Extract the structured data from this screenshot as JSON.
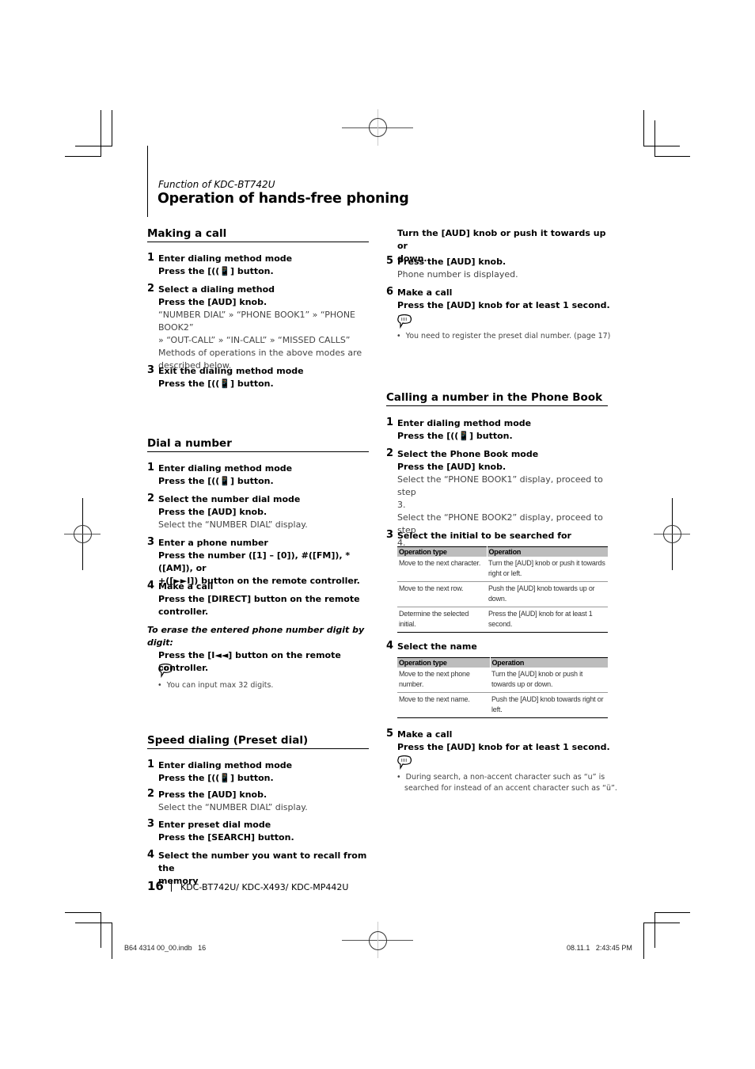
{
  "header": {
    "function_label": "Function of KDC-BT742U",
    "title": "Operation of hands-free phoning"
  },
  "making_a_call": {
    "heading": "Making a call",
    "steps": [
      {
        "num": "1",
        "title": "Enter dialing method mode",
        "action_pre": "Press the [",
        "action_post": "] button.",
        "icon": "phone-call-icon"
      },
      {
        "num": "2",
        "title": "Select a dialing method",
        "action": "Press the [AUD] knob.",
        "desc": [
          "“NUMBER DIAL” » “PHONE BOOK1” » “PHONE BOOK2”",
          "» “OUT-CALL” » “IN-CALL” » “MISSED CALLS”",
          "Methods of operations in the above modes are",
          "described below."
        ]
      },
      {
        "num": "3",
        "title": "Exit the dialing method mode",
        "action_pre": "Press the [",
        "action_post": "] button.",
        "icon": "phone-call-icon"
      }
    ]
  },
  "dial_a_number": {
    "heading": "Dial a number",
    "steps": [
      {
        "num": "1",
        "title": "Enter dialing method mode",
        "action_pre": "Press the [",
        "action_post": "] button.",
        "icon": "phone-call-icon"
      },
      {
        "num": "2",
        "title": "Select the number dial mode",
        "action": "Press the [AUD] knob.",
        "desc": "Select the “NUMBER DIAL” display."
      },
      {
        "num": "3",
        "title": "Enter a phone number",
        "action_line1": "Press the number ([1] – [0]), #([FM]), *([AM]), or",
        "action_line2": "+([►►I]) button on the remote controller."
      },
      {
        "num": "4",
        "title": "Make a call",
        "action_line1": "Press the [DIRECT] button on the remote",
        "action_line2": "controller."
      }
    ],
    "erase_heading_line1": "To erase the entered phone number digit by",
    "erase_heading_line2": "digit:",
    "erase_action": "Press the [I◄◄] button on the remote controller.",
    "note": "You can input max 32 digits."
  },
  "speed_dialing": {
    "heading": "Speed dialing (Preset dial)",
    "steps": [
      {
        "num": "1",
        "title": "Enter dialing method mode",
        "action_pre": "Press the [",
        "action_post": "] button.",
        "icon": "phone-call-icon"
      },
      {
        "num": "2",
        "title": "Press the [AUD] knob.",
        "desc": "Select the “NUMBER DIAL” display."
      },
      {
        "num": "3",
        "title": "Enter preset dial mode",
        "action": "Press the [SEARCH] button."
      },
      {
        "num": "4",
        "title_line1": "Select the number you want to recall from the",
        "title_line2": "memory"
      },
      {
        "num": "",
        "action_line1": "Turn the [AUD] knob or push it towards up or",
        "action_line2": "down."
      },
      {
        "num": "5",
        "title": "Press the [AUD] knob.",
        "desc": "Phone number is displayed."
      },
      {
        "num": "6",
        "title": "Make a call",
        "action": "Press the [AUD] knob for at least 1 second."
      }
    ],
    "note": "You need to register the preset dial number. (page 17)"
  },
  "phone_book": {
    "heading": "Calling a number in the Phone Book",
    "steps": [
      {
        "num": "1",
        "title": "Enter dialing method mode",
        "action_pre": "Press the [",
        "action_post": "] button.",
        "icon": "phone-call-icon"
      },
      {
        "num": "2",
        "title": "Select the Phone Book mode",
        "action": "Press the [AUD] knob.",
        "desc": [
          "Select the “PHONE BOOK1” display, proceed to step",
          "3.",
          "Select the “PHONE BOOK2” display, proceed to step",
          "4."
        ]
      },
      {
        "num": "3",
        "title": "Select the initial to be searched for"
      },
      {
        "num": "4",
        "title": "Select the name"
      },
      {
        "num": "5",
        "title": "Make a call",
        "action": "Press the [AUD] knob for at least 1 second."
      }
    ],
    "table_initial": {
      "headers": [
        "Operation type",
        "Operation"
      ],
      "rows": [
        [
          "Move to the next character.",
          "Turn the [AUD] knob or push it towards right or left."
        ],
        [
          "Move to the next row.",
          "Push the [AUD] knob towards up or down."
        ],
        [
          "Determine the selected initial.",
          "Press the [AUD] knob for at least 1 second."
        ]
      ]
    },
    "table_name": {
      "headers": [
        "Operation type",
        "Operation"
      ],
      "rows": [
        [
          "Move to the next phone number.",
          "Turn the [AUD] knob or push it towards up or down."
        ],
        [
          "Move to the next name.",
          "Push the [AUD] knob towards right or left."
        ]
      ]
    },
    "note_line1": "During search, a non-accent character such as “u” is",
    "note_line2": "searched for instead of an accent character such as “ü”."
  },
  "footer": {
    "page_number": "16",
    "models": "KDC-BT742U/ KDC-X493/ KDC-MP442U",
    "slug_file": "B64 4314 00_00.indb   16",
    "slug_date": "08.11.1   2:43:45 PM"
  }
}
